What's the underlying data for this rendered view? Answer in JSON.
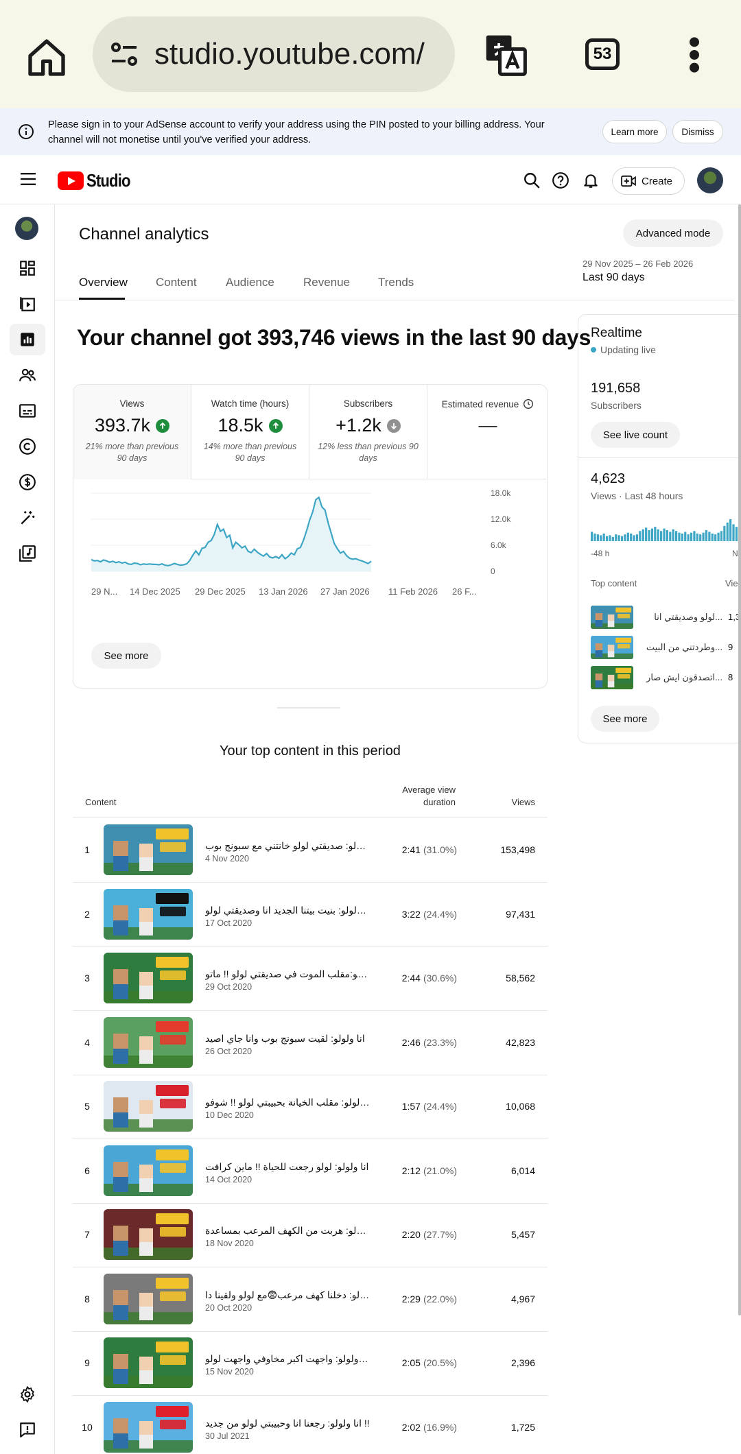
{
  "browser": {
    "url": "studio.youtube.com/",
    "tab_count": "53"
  },
  "banner": {
    "message": "Please sign in to your AdSense account to verify your address using the PIN posted to your billing address. Your channel will not monetise until you've verified your address.",
    "learn_more": "Learn more",
    "dismiss": "Dismiss"
  },
  "header": {
    "logo_text": "Studio",
    "create_label": "Create"
  },
  "page": {
    "title": "Channel analytics",
    "advanced_mode": "Advanced mode",
    "date_range": "29 Nov 2025 – 26 Feb 2026",
    "date_label": "Last 90 days",
    "tabs": [
      "Overview",
      "Content",
      "Audience",
      "Revenue",
      "Trends"
    ],
    "headline": "Your channel got 393,746 views in the last 90 days"
  },
  "metrics": [
    {
      "label": "Views",
      "value": "393.7k",
      "trend": "up",
      "note": "21% more than previous 90 days"
    },
    {
      "label": "Watch time (hours)",
      "value": "18.5k",
      "trend": "up",
      "note": "14% more than previous 90 days"
    },
    {
      "label": "Subscribers",
      "value": "+1.2k",
      "trend": "down",
      "note": "12% less than previous 90 days"
    },
    {
      "label": "Estimated revenue",
      "value": "—",
      "trend": "",
      "note": ""
    }
  ],
  "chart_data": {
    "type": "area",
    "y_ticks": [
      "18.0k",
      "12.0k",
      "6.0k",
      "0"
    ],
    "x_tick_labels": [
      "29 N...",
      "14 Dec 2025",
      "29 Dec 2025",
      "13 Jan 2026",
      "27 Jan 2026",
      "11 Feb 2026",
      "26 F..."
    ],
    "ylim": [
      0,
      18000
    ],
    "values": [
      2700,
      2400,
      2500,
      2200,
      2600,
      2400,
      2100,
      2300,
      2000,
      2200,
      1900,
      2100,
      1700,
      1600,
      1900,
      1800,
      1500,
      1700,
      1600,
      1700,
      1600,
      1600,
      1500,
      1700,
      1400,
      1300,
      1500,
      1800,
      1600,
      1400,
      1500,
      1700,
      2500,
      3700,
      4700,
      3800,
      5300,
      5500,
      6700,
      7100,
      8500,
      10800,
      9200,
      9700,
      7800,
      8300,
      5400,
      6700,
      6100,
      5400,
      5800,
      4600,
      4300,
      5100,
      4400,
      3900,
      3500,
      4100,
      3300,
      3100,
      3400,
      3000,
      3800,
      2900,
      3400,
      4200,
      3800,
      5200,
      5500,
      7200,
      9300,
      11800,
      13700,
      16500,
      17000,
      14800,
      14100,
      11200,
      8800,
      6400,
      5200,
      4200,
      4600,
      3600,
      3000,
      2800,
      2900,
      2600,
      2400,
      2100,
      1800,
      2300
    ],
    "see_more": "See more"
  },
  "top_content": {
    "title": "Your top content in this period",
    "col_content": "Content",
    "col_avd": "Average view duration",
    "col_views": "Views",
    "rows": [
      {
        "rank": "1",
        "title": "انا ولولو: صديقتي لولو خانتني مع سبونج بوب",
        "date": "4 Nov 2020",
        "duration": "2:41",
        "pct": "(31.0%)",
        "views": "153,498",
        "bg": "#3f8fb0",
        "accent": "#f2c22b"
      },
      {
        "rank": "2",
        "title": "انا ولولو: بنيت بيتنا الجديد انا وصديقتي لولو",
        "date": "17 Oct 2020",
        "duration": "3:22",
        "pct": "(24.4%)",
        "views": "97,431",
        "bg": "#4ab0d8",
        "accent": "#111111"
      },
      {
        "rank": "3",
        "title": "انا ولولو:مقلب الموت في صديقتي لولو !! ماتو",
        "date": "29 Oct 2020",
        "duration": "2:44",
        "pct": "(30.6%)",
        "views": "58,562",
        "bg": "#2f7d3e",
        "accent": "#f2c22b"
      },
      {
        "rank": "4",
        "title": "انا ولولو: لقيت سبونج بوب وانا جاي اصيد",
        "date": "26 Oct 2020",
        "duration": "2:46",
        "pct": "(23.3%)",
        "views": "42,823",
        "bg": "#5aa060",
        "accent": "#e33b2e"
      },
      {
        "rank": "5",
        "title": "انا ولولو: مقلب الخيانة بحبيبتي لولو !! شوفو",
        "date": "10 Dec 2020",
        "duration": "1:57",
        "pct": "(24.4%)",
        "views": "10,068",
        "bg": "#dfe8f0",
        "accent": "#d9212b"
      },
      {
        "rank": "6",
        "title": "انا ولولو: لولو رجعت للحياة !! ماين كرافت",
        "date": "14 Oct 2020",
        "duration": "2:12",
        "pct": "(21.0%)",
        "views": "6,014",
        "bg": "#4aa6d4",
        "accent": "#f2c22b"
      },
      {
        "rank": "7",
        "title": "انا ولولو: هربت من الكهف المرعب بمساعدة",
        "date": "18 Nov 2020",
        "duration": "2:20",
        "pct": "(27.7%)",
        "views": "5,457",
        "bg": "#6b2a2a",
        "accent": "#f2c22b"
      },
      {
        "rank": "8",
        "title": "انا ولولو: دخلنا كهف مرعب😨مع لولو ولقينا دا",
        "date": "20 Oct 2020",
        "duration": "2:29",
        "pct": "(22.0%)",
        "views": "4,967",
        "bg": "#7a7a7a",
        "accent": "#f2c22b"
      },
      {
        "rank": "9",
        "title": "انا ولولو: واجهت اكبر مخاوفي واجهت لولو !",
        "date": "15 Nov 2020",
        "duration": "2:05",
        "pct": "(20.5%)",
        "views": "2,396",
        "bg": "#2f7d3e",
        "accent": "#f2c22b"
      },
      {
        "rank": "10",
        "title": "انا ولولو: رجعنا انا وحبيبتي لولو من جديد !!",
        "date": "30 Jul 2021",
        "duration": "2:02",
        "pct": "(16.9%)",
        "views": "1,725",
        "bg": "#5ab0e0",
        "accent": "#e0202a"
      }
    ]
  },
  "realtime": {
    "title": "Realtime",
    "live": "Updating live",
    "subscribers": "191,658",
    "subscribers_label": "Subscribers",
    "see_live": "See live count",
    "views": "4,623",
    "views_label": "Views · Last 48 hours",
    "bar_values": [
      11,
      9,
      8,
      7,
      9,
      6,
      7,
      5,
      8,
      7,
      6,
      8,
      10,
      9,
      7,
      8,
      12,
      14,
      16,
      13,
      15,
      17,
      14,
      12,
      15,
      13,
      11,
      14,
      12,
      10,
      9,
      11,
      8,
      10,
      12,
      9,
      8,
      10,
      13,
      11,
      9,
      8,
      10,
      12,
      18,
      22,
      26,
      20,
      17,
      19,
      15
    ],
    "axis_left": "-48 h",
    "axis_right": "N",
    "top_content": "Top content",
    "top_views": "Vie",
    "items": [
      {
        "title": "لولو وصديقتي انا...",
        "views": "1,3",
        "bg": "#3f8fb0"
      },
      {
        "title": "وطردتني من البيت...",
        "views": "9",
        "bg": "#4aa6d4"
      },
      {
        "title": "اتصدقون ايش صار...",
        "views": "8",
        "bg": "#2f7d3e"
      }
    ],
    "see_more": "See more"
  }
}
